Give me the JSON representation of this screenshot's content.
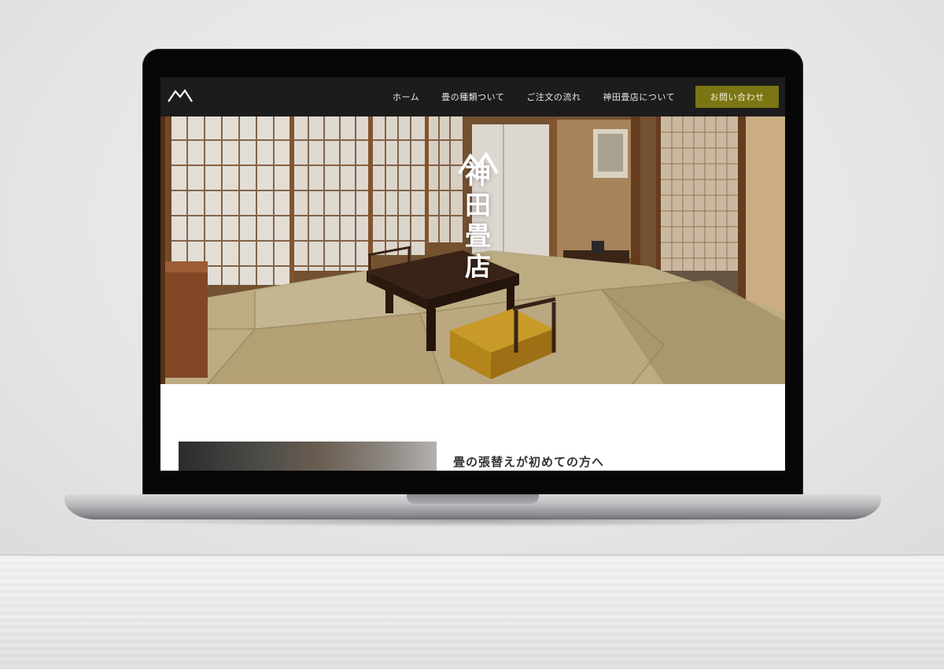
{
  "nav": {
    "logo_icon": "mountain-logo-icon",
    "items": [
      {
        "label": "ホーム"
      },
      {
        "label": "畳の種類ついて"
      },
      {
        "label": "ご注文の流れ"
      },
      {
        "label": "神田畳店について"
      }
    ],
    "contact_label": "お問い合わせ",
    "colors": {
      "bar": "#1c1c1c",
      "contact_bg": "#7b7613"
    }
  },
  "hero": {
    "brand_icon": "mountain-logo-icon",
    "brand_title": "神田畳店",
    "image": "japanese-tatami-room-photo"
  },
  "intro": {
    "heading": "畳の張替えが初めての方へ",
    "image": "section-photo"
  }
}
